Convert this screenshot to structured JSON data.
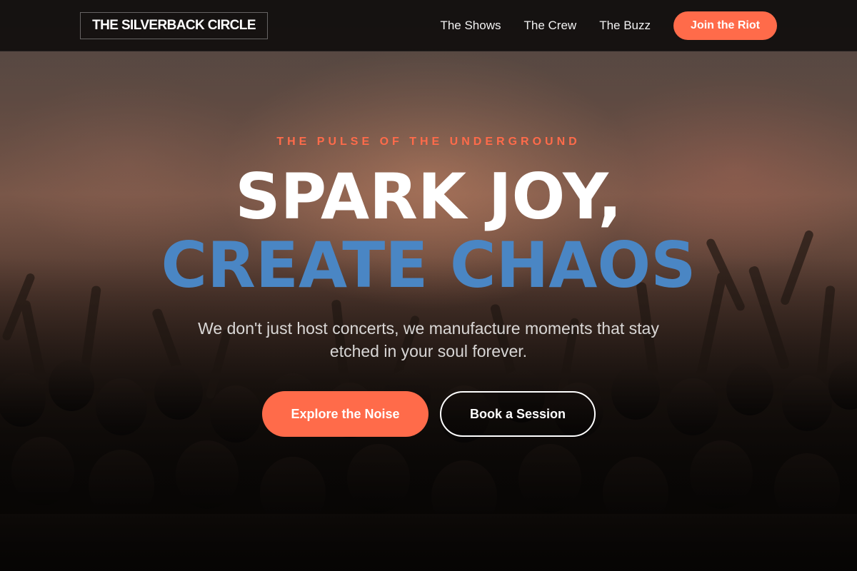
{
  "brand": {
    "logo_text": "THE SILVERBACK CIRCLE"
  },
  "nav": {
    "links": [
      {
        "label": "The Shows"
      },
      {
        "label": "The Crew"
      },
      {
        "label": "The Buzz"
      }
    ],
    "cta_label": "Join the Riot"
  },
  "hero": {
    "eyebrow": "THE PULSE OF THE UNDERGROUND",
    "headline_line1": "SPARK JOY,",
    "headline_line2": "CREATE CHAOS",
    "subtitle": "We don't just host concerts, we manufacture moments that stay etched in your soul forever.",
    "primary_button": "Explore the Noise",
    "secondary_button": "Book a Session"
  },
  "colors": {
    "accent": "#ff6b4a",
    "headline_blue": "#4a86c4",
    "navbar_bg": "#121010"
  }
}
